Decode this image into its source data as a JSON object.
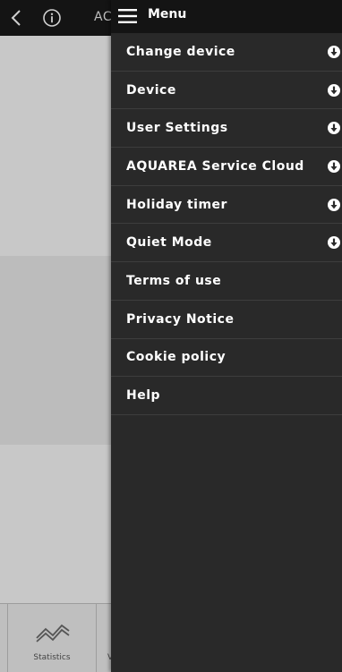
{
  "app": {
    "title": "AC",
    "footer": {
      "tabs": [
        {
          "label": "Statistics",
          "icon": "statistics-icon"
        },
        {
          "label": "V",
          "icon": ""
        }
      ]
    }
  },
  "menu": {
    "title": "Menu",
    "items": [
      {
        "label": "Change device",
        "expandable": true
      },
      {
        "label": "Device",
        "expandable": true
      },
      {
        "label": "User Settings",
        "expandable": true
      },
      {
        "label": "AQUAREA Service Cloud",
        "expandable": true
      },
      {
        "label": "Holiday timer",
        "expandable": true
      },
      {
        "label": "Quiet Mode",
        "expandable": true
      },
      {
        "label": "Terms of use",
        "expandable": false
      },
      {
        "label": "Privacy Notice",
        "expandable": false
      },
      {
        "label": "Cookie policy",
        "expandable": false
      },
      {
        "label": "Help",
        "expandable": false
      }
    ]
  },
  "colors": {
    "menu_background": "#292929",
    "header_background": "#141414",
    "divider": "#3d3d3d",
    "text": "#ffffff"
  }
}
